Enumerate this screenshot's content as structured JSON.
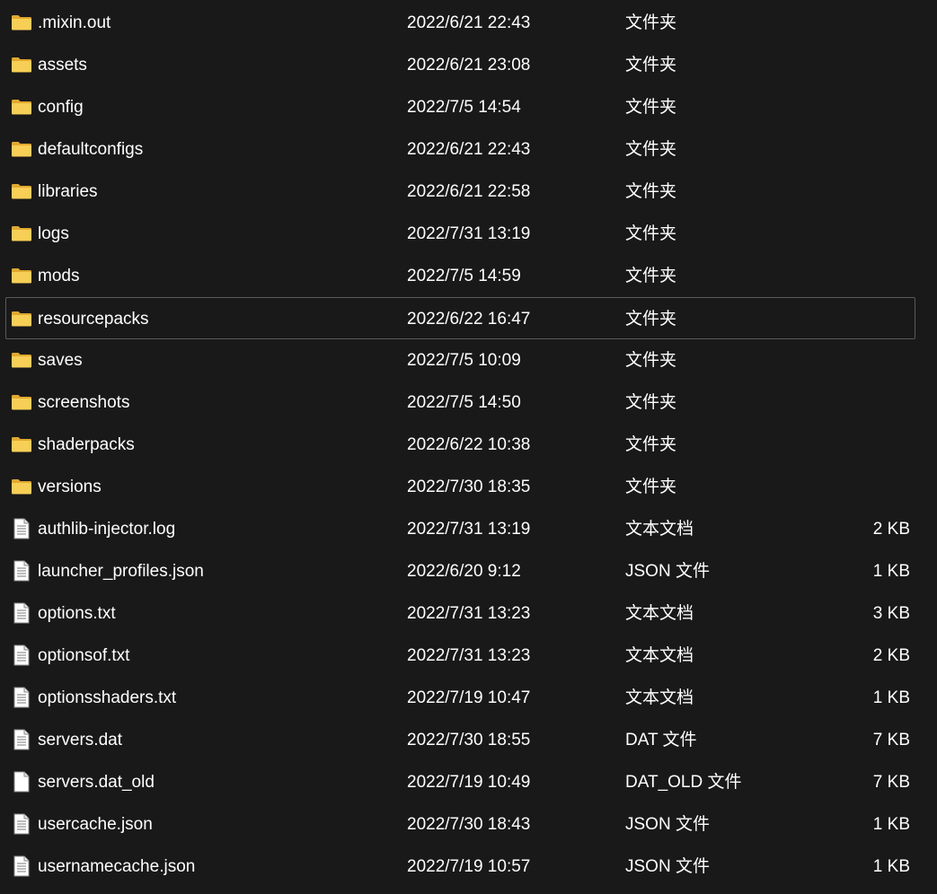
{
  "files": [
    {
      "name": ".mixin.out",
      "date": "2022/6/21 22:43",
      "type": "文件夹",
      "size": "",
      "icon": "folder-icon"
    },
    {
      "name": "assets",
      "date": "2022/6/21 23:08",
      "type": "文件夹",
      "size": "",
      "icon": "folder-icon"
    },
    {
      "name": "config",
      "date": "2022/7/5 14:54",
      "type": "文件夹",
      "size": "",
      "icon": "folder-icon"
    },
    {
      "name": "defaultconfigs",
      "date": "2022/6/21 22:43",
      "type": "文件夹",
      "size": "",
      "icon": "folder-icon"
    },
    {
      "name": "libraries",
      "date": "2022/6/21 22:58",
      "type": "文件夹",
      "size": "",
      "icon": "folder-icon"
    },
    {
      "name": "logs",
      "date": "2022/7/31 13:19",
      "type": "文件夹",
      "size": "",
      "icon": "folder-icon"
    },
    {
      "name": "mods",
      "date": "2022/7/5 14:59",
      "type": "文件夹",
      "size": "",
      "icon": "folder-icon"
    },
    {
      "name": "resourcepacks",
      "date": "2022/6/22 16:47",
      "type": "文件夹",
      "size": "",
      "icon": "folder-icon",
      "selected": true
    },
    {
      "name": "saves",
      "date": "2022/7/5 10:09",
      "type": "文件夹",
      "size": "",
      "icon": "folder-icon"
    },
    {
      "name": "screenshots",
      "date": "2022/7/5 14:50",
      "type": "文件夹",
      "size": "",
      "icon": "folder-icon"
    },
    {
      "name": "shaderpacks",
      "date": "2022/6/22 10:38",
      "type": "文件夹",
      "size": "",
      "icon": "folder-icon"
    },
    {
      "name": "versions",
      "date": "2022/7/30 18:35",
      "type": "文件夹",
      "size": "",
      "icon": "folder-icon"
    },
    {
      "name": "authlib-injector.log",
      "date": "2022/7/31 13:19",
      "type": "文本文档",
      "size": "2 KB",
      "icon": "text-file-icon"
    },
    {
      "name": "launcher_profiles.json",
      "date": "2022/6/20 9:12",
      "type": "JSON 文件",
      "size": "1 KB",
      "icon": "text-file-icon"
    },
    {
      "name": "options.txt",
      "date": "2022/7/31 13:23",
      "type": "文本文档",
      "size": "3 KB",
      "icon": "text-file-icon"
    },
    {
      "name": "optionsof.txt",
      "date": "2022/7/31 13:23",
      "type": "文本文档",
      "size": "2 KB",
      "icon": "text-file-icon"
    },
    {
      "name": "optionsshaders.txt",
      "date": "2022/7/19 10:47",
      "type": "文本文档",
      "size": "1 KB",
      "icon": "text-file-icon"
    },
    {
      "name": "servers.dat",
      "date": "2022/7/30 18:55",
      "type": "DAT 文件",
      "size": "7 KB",
      "icon": "text-file-icon"
    },
    {
      "name": "servers.dat_old",
      "date": "2022/7/19 10:49",
      "type": "DAT_OLD 文件",
      "size": "7 KB",
      "icon": "blank-file-icon"
    },
    {
      "name": "usercache.json",
      "date": "2022/7/30 18:43",
      "type": "JSON 文件",
      "size": "1 KB",
      "icon": "text-file-icon"
    },
    {
      "name": "usernamecache.json",
      "date": "2022/7/19 10:57",
      "type": "JSON 文件",
      "size": "1 KB",
      "icon": "text-file-icon"
    }
  ],
  "colors": {
    "background": "#191919",
    "text": "#ffffff",
    "selection_border": "#5a5a5a",
    "folder_yellow": "#f8cf56",
    "folder_back": "#e0a92e"
  }
}
